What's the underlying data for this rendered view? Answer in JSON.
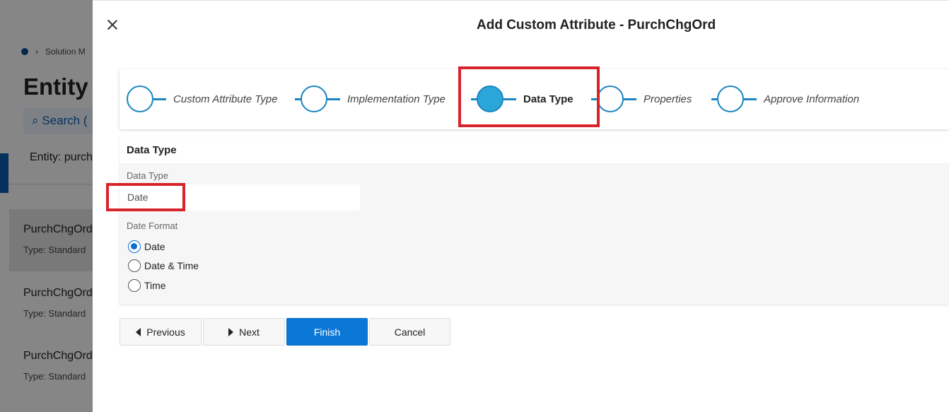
{
  "background": {
    "breadcrumb": "Solution M",
    "title": "Entity",
    "search": "Search (",
    "entity_label": "Entity: purch",
    "list": [
      {
        "name": "PurchChgOrd",
        "type": "Type:   Standard"
      },
      {
        "name": "PurchChgOrd",
        "type": "Type:   Standard"
      },
      {
        "name": "PurchChgOrd",
        "type": "Type:   Standard"
      }
    ]
  },
  "panel": {
    "title": "Add Custom Attribute - PurchChgOrd",
    "steps": [
      {
        "label": "Custom Attribute Type"
      },
      {
        "label": "Implementation Type"
      },
      {
        "label": "Data Type"
      },
      {
        "label": "Properties"
      },
      {
        "label": "Approve Information"
      }
    ],
    "section_title": "Data Type",
    "data_type_label": "Data Type",
    "data_type_value": "Date",
    "date_format_label": "Date Format",
    "date_format_options": [
      "Date",
      "Date & Time",
      "Time"
    ],
    "date_format_selected": "Date",
    "buttons": {
      "previous": "Previous",
      "next": "Next",
      "finish": "Finish",
      "cancel": "Cancel"
    }
  },
  "colors": {
    "accent": "#0b78d7",
    "step_active": "#2aa7d8",
    "highlight": "#d8232a"
  }
}
